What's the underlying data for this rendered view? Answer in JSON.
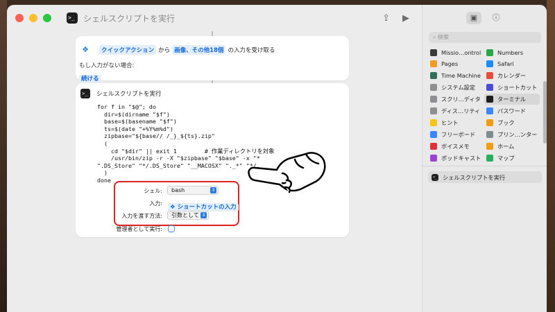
{
  "window": {
    "title": "シェルスクリプトを実行"
  },
  "action1": {
    "token1": "クイックアクション",
    "from": "から",
    "token2": "画像、その他18個",
    "suffix": "の入力を受け取る",
    "no_input_label": "もし入力がない場合:",
    "continue_token": "続ける"
  },
  "action2": {
    "title": "シェルスクリプトを実行",
    "code": "for f in \"$@\"; do\n  dir=$(dirname \"$f\")\n  base=$(basename \"$f\")\n  ts=$(date \"+%Y%m%d\")\n  zipbase=\"${base// /_}_${ts}.zip\"\n  (\n    cd \"$dir\" || exit 1        # 作業ディレクトリを対象\n    /usr/bin/zip -r -X \"$zipbase\" \"$base\" -x \"*\n\".DS_Store\" \"*/.DS_Store\" \"__MACOSX\" \"._*\" \"*/.\n  )\ndone",
    "shell_label": "シェル:",
    "shell_value": "bash",
    "input_label": "入力:",
    "input_value": "ショートカットの入力",
    "pass_label": "入力を渡す方法:",
    "pass_value": "引数として",
    "admin_label": "管理者として実行:"
  },
  "sidebar": {
    "search_placeholder": "検索",
    "items_left": [
      {
        "label": "Missio…ontrol",
        "color": "#3a3a3c"
      },
      {
        "label": "Pages",
        "color": "#f29b22"
      },
      {
        "label": "Time Machine",
        "color": "#2f6e5a"
      },
      {
        "label": "システム設定",
        "color": "#8e8e93"
      },
      {
        "label": "スクリ…ディタ",
        "color": "#8e8e93"
      },
      {
        "label": "ディス…リティ",
        "color": "#8e8e93"
      },
      {
        "label": "ヒント",
        "color": "#f5c518"
      },
      {
        "label": "フリーボード",
        "color": "#3a86ff"
      },
      {
        "label": "ボイスメモ",
        "color": "#e0303a"
      },
      {
        "label": "ポッドキャスト",
        "color": "#9b41d6"
      }
    ],
    "items_right": [
      {
        "label": "Numbers",
        "color": "#27a845"
      },
      {
        "label": "Safari",
        "color": "#1a8cff"
      },
      {
        "label": "カレンダー",
        "color": "#e74c3c"
      },
      {
        "label": "ショートカット",
        "color": "#4b4bd6"
      },
      {
        "label": "ターミナル",
        "color": "#1e1e1e"
      },
      {
        "label": "パスワード",
        "color": "#3a86ff"
      },
      {
        "label": "ブック",
        "color": "#f39c12"
      },
      {
        "label": "プリン…ンター",
        "color": "#7f8c8d"
      },
      {
        "label": "ホーム",
        "color": "#f39c12"
      },
      {
        "label": "マップ",
        "color": "#27ae60"
      }
    ],
    "recent": "シェルスクリプトを実行"
  }
}
